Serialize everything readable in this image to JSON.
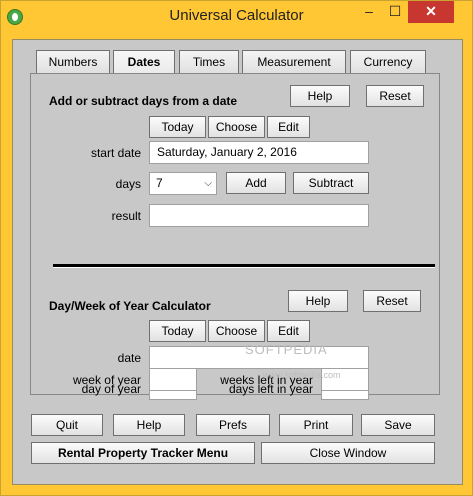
{
  "window": {
    "title": "Universal Calculator",
    "minimize_glyph": "–",
    "maximize_glyph": "☐",
    "close_glyph": "✕"
  },
  "tabs": [
    {
      "label": "Numbers",
      "active": false
    },
    {
      "label": "Dates",
      "active": true
    },
    {
      "label": "Times",
      "active": false
    },
    {
      "label": "Measurement",
      "active": false
    },
    {
      "label": "Currency",
      "active": false
    }
  ],
  "add_subtract": {
    "heading": "Add or subtract days from a date",
    "help_label": "Help",
    "reset_label": "Reset",
    "today_label": "Today",
    "choose_label": "Choose",
    "edit_label": "Edit",
    "start_date_label": "start date",
    "start_date_value": "Saturday, January 2, 2016",
    "days_label": "days",
    "days_value": "7",
    "add_label": "Add",
    "subtract_label": "Subtract",
    "result_label": "result",
    "result_value": ""
  },
  "week_of_year": {
    "heading": "Day/Week of Year Calculator",
    "help_label": "Help",
    "reset_label": "Reset",
    "today_label": "Today",
    "choose_label": "Choose",
    "edit_label": "Edit",
    "date_label": "date",
    "date_value": "",
    "day_of_year_label": "day of year",
    "day_of_year_value": "",
    "days_left_label": "days left in year",
    "days_left_value": "",
    "week_of_year_label": "week of year",
    "week_of_year_value": "",
    "weeks_left_label": "weeks left in year",
    "weeks_left_value": ""
  },
  "footer": {
    "quit_label": "Quit",
    "help_label": "Help",
    "prefs_label": "Prefs",
    "print_label": "Print",
    "save_label": "Save",
    "rental_label": "Rental Property Tracker Menu",
    "close_window_label": "Close Window"
  },
  "watermark": {
    "text": "SOFTPEDIA",
    "subtext": "www.softpedia.com"
  },
  "colors": {
    "title_bar": "#ffc733",
    "client_background": "#c8c8c8",
    "close_button": "#c7372f"
  }
}
